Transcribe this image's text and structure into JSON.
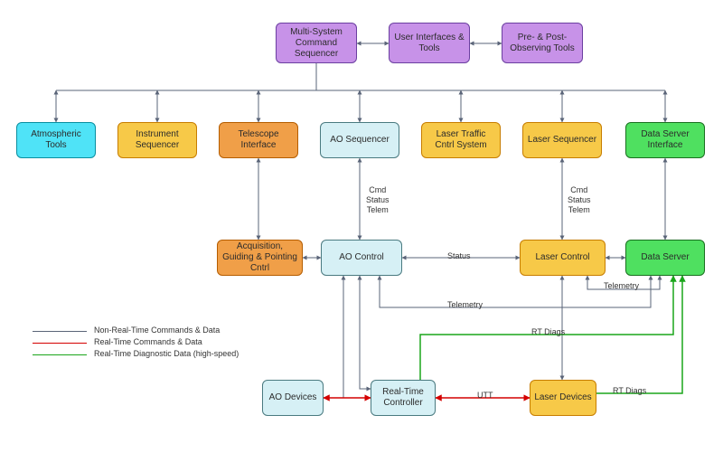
{
  "chart_data": {
    "type": "diagram",
    "title": "",
    "nodes": [
      {
        "id": "multi",
        "label": "Multi-System Command Sequencer",
        "color": "purple",
        "row": 0
      },
      {
        "id": "ui",
        "label": "User Interfaces & Tools",
        "color": "purple",
        "row": 0
      },
      {
        "id": "preobs",
        "label": "Pre- & Post-Observing Tools",
        "color": "purple",
        "row": 0
      },
      {
        "id": "atm",
        "label": "Atmospheric Tools",
        "color": "cyan",
        "row": 1
      },
      {
        "id": "instseq",
        "label": "Instrument Sequencer",
        "color": "yellow",
        "row": 1
      },
      {
        "id": "telif",
        "label": "Telescope Interface",
        "color": "orange",
        "row": 1
      },
      {
        "id": "aoseq",
        "label": "AO Sequencer",
        "color": "lightblue",
        "row": 1
      },
      {
        "id": "ltc",
        "label": "Laser Traffic Cntrl System",
        "color": "yellow",
        "row": 1
      },
      {
        "id": "laserseq",
        "label": "Laser Sequencer",
        "color": "yellow",
        "row": 1
      },
      {
        "id": "dsif",
        "label": "Data Server Interface",
        "color": "green",
        "row": 1
      },
      {
        "id": "agp",
        "label": "Acquisition, Guiding & Pointing Cntrl",
        "color": "orange",
        "row": 2
      },
      {
        "id": "aoctrl",
        "label": "AO Control",
        "color": "lightblue",
        "row": 2
      },
      {
        "id": "laserctrl",
        "label": "Laser Control",
        "color": "yellow",
        "row": 2
      },
      {
        "id": "ds",
        "label": "Data Server",
        "color": "green",
        "row": 2
      },
      {
        "id": "aodev",
        "label": "AO Devices",
        "color": "lightblue",
        "row": 3
      },
      {
        "id": "rtc",
        "label": "Real-Time Controller",
        "color": "lightblue",
        "row": 3
      },
      {
        "id": "laserdev",
        "label": "Laser Devices",
        "color": "yellow",
        "row": 3
      }
    ],
    "edges": [
      {
        "from": "multi",
        "to": "ui",
        "type": "nonrt"
      },
      {
        "from": "ui",
        "to": "preobs",
        "type": "nonrt"
      },
      {
        "from": "multi",
        "to": "atm",
        "type": "nonrt"
      },
      {
        "from": "multi",
        "to": "instseq",
        "type": "nonrt"
      },
      {
        "from": "multi",
        "to": "telif",
        "type": "nonrt"
      },
      {
        "from": "multi",
        "to": "aoseq",
        "type": "nonrt"
      },
      {
        "from": "multi",
        "to": "ltc",
        "type": "nonrt"
      },
      {
        "from": "multi",
        "to": "laserseq",
        "type": "nonrt"
      },
      {
        "from": "multi",
        "to": "dsif",
        "type": "nonrt"
      },
      {
        "from": "telif",
        "to": "agp",
        "type": "nonrt"
      },
      {
        "from": "aoseq",
        "to": "aoctrl",
        "type": "nonrt",
        "label": "Cmd Status Telem"
      },
      {
        "from": "laserseq",
        "to": "laserctrl",
        "type": "nonrt",
        "label": "Cmd Status Telem"
      },
      {
        "from": "dsif",
        "to": "ds",
        "type": "nonrt"
      },
      {
        "from": "agp",
        "to": "aoctrl",
        "type": "nonrt"
      },
      {
        "from": "aoctrl",
        "to": "laserctrl",
        "type": "nonrt",
        "label": "Status"
      },
      {
        "from": "laserctrl",
        "to": "ds",
        "type": "nonrt"
      },
      {
        "from": "aoctrl",
        "to": "aodev",
        "type": "nonrt"
      },
      {
        "from": "aoctrl",
        "to": "rtc",
        "type": "nonrt"
      },
      {
        "from": "laserctrl",
        "to": "laserdev",
        "type": "nonrt"
      },
      {
        "from": "aoctrl",
        "to": "ds",
        "type": "nonrt",
        "label": "Telemetry"
      },
      {
        "from": "laserctrl",
        "to": "ds",
        "type": "nonrt",
        "label": "Telemetry"
      },
      {
        "from": "aodev",
        "to": "rtc",
        "type": "rt"
      },
      {
        "from": "rtc",
        "to": "laserdev",
        "type": "rt",
        "label": "UTT"
      },
      {
        "from": "rtc",
        "to": "ds",
        "type": "rtdiag",
        "label": "RT Diags"
      },
      {
        "from": "laserdev",
        "to": "ds",
        "type": "rtdiag",
        "label": "RT Diags"
      }
    ],
    "legend": [
      {
        "color": "#5a6478",
        "label": "Non-Real-Time Commands & Data"
      },
      {
        "color": "#d40000",
        "label": "Real-Time Commands & Data"
      },
      {
        "color": "#1aa51a",
        "label": "Real-Time Diagnostic Data (high-speed)"
      }
    ],
    "edge_labels": {
      "cmd_status_telem_left": "Cmd\nStatus\nTelem",
      "cmd_status_telem_right": "Cmd\nStatus\nTelem",
      "status": "Status",
      "telemetry_upper": "Telemetry",
      "telemetry_lower": "Telemetry",
      "rtdiags_upper": "RT Diags",
      "rtdiags_lower": "RT Diags",
      "utt": "UTT"
    }
  }
}
